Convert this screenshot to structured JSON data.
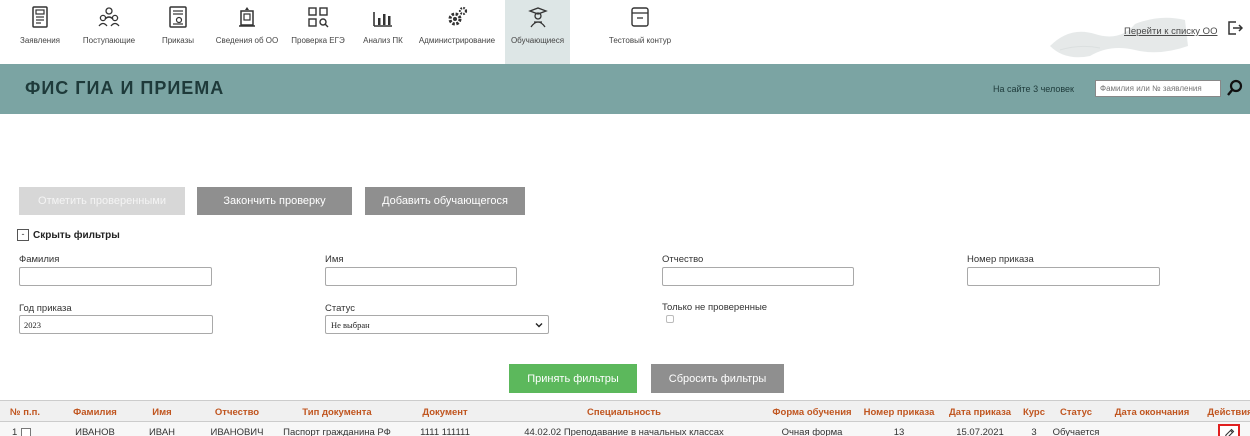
{
  "nav": {
    "items": [
      {
        "label": "Заявления",
        "icon": "applications-icon"
      },
      {
        "label": "Поступающие",
        "icon": "applicants-icon"
      },
      {
        "label": "Приказы",
        "icon": "orders-icon"
      },
      {
        "label": "Сведения об ОО",
        "icon": "org-info-icon"
      },
      {
        "label": "Проверка ЕГЭ",
        "icon": "exam-check-icon"
      },
      {
        "label": "Анализ ПК",
        "icon": "analysis-icon"
      },
      {
        "label": "Администрирование",
        "icon": "admin-gear-icon"
      },
      {
        "label": "Обучающиеся",
        "icon": "students-icon"
      },
      {
        "label": "Тестовый контур",
        "icon": "test-contour-icon"
      }
    ],
    "active_index": 7,
    "org_list_link": "Перейти к списку ОО"
  },
  "header": {
    "title": "ФИС ГИА И ПРИЕМА",
    "online_text": "На сайте 3 человек",
    "search_placeholder": "Фамилия или № заявления"
  },
  "actions": {
    "mark_checked": "Отметить проверенными",
    "finish_check": "Закончить проверку",
    "add_student": "Добавить обучающегося"
  },
  "filters": {
    "toggle_symbol": "-",
    "toggle_label": "Скрыть фильтры",
    "surname_label": "Фамилия",
    "surname_value": "",
    "name_label": "Имя",
    "name_value": "",
    "patronymic_label": "Отчество",
    "patronymic_value": "",
    "order_number_label": "Номер приказа",
    "order_number_value": "",
    "order_year_label": "Год приказа",
    "order_year_value": "2023",
    "status_label": "Статус",
    "status_value": "Не выбран",
    "unchecked_only_label": "Только не проверенные",
    "apply": "Принять фильтры",
    "reset": "Сбросить фильтры"
  },
  "table": {
    "headers": [
      "№ п.п.",
      "Фамилия",
      "Имя",
      "Отчество",
      "Тип документа",
      "Документ",
      "Специальность",
      "Форма обучения",
      "Номер приказа",
      "Дата приказа",
      "Курс",
      "Статус",
      "Дата окончания",
      "Действия"
    ],
    "rows": [
      {
        "num": "1",
        "surname": "ИВАНОВ",
        "name": "ИВАН",
        "patronymic": "ИВАНОВИЧ",
        "doc_type": "Паспорт гражданина РФ",
        "document": "1111 111111",
        "specialty": "44.02.02 Преподавание в начальных классах",
        "study_form": "Очная форма",
        "order_number": "13",
        "order_date": "15.07.2021",
        "course": "3",
        "status": "Обучается",
        "end_date": ""
      }
    ]
  }
}
